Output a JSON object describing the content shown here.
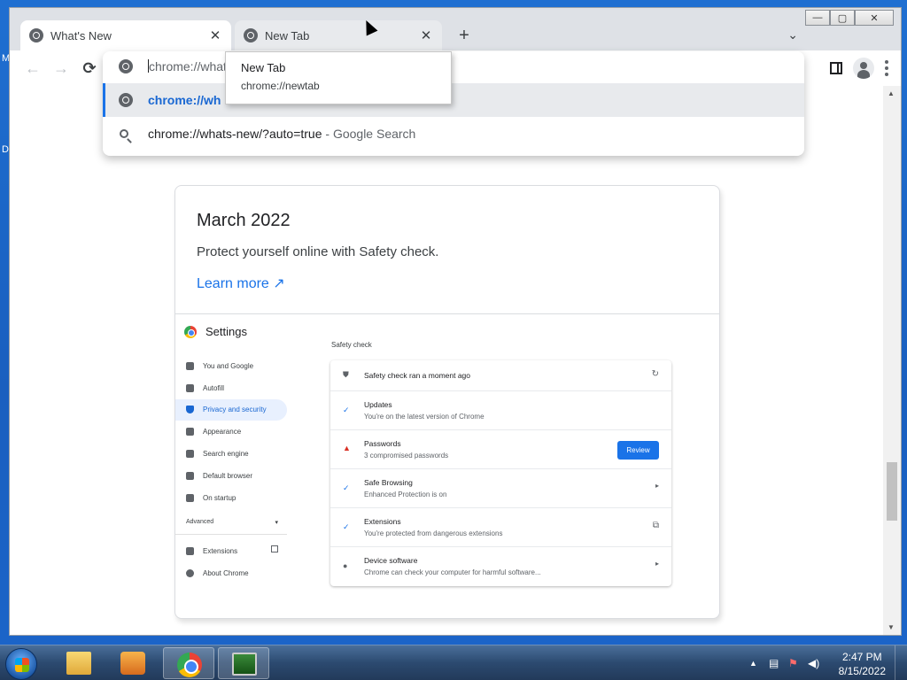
{
  "window": {
    "tabs": [
      {
        "label": "What's New",
        "active": true
      },
      {
        "label": "New Tab",
        "active": false
      }
    ],
    "new_tab_symbol": "+",
    "controls": {
      "minimize": "—",
      "maximize": "▢",
      "close": "✕"
    }
  },
  "toolbar": {
    "back": "←",
    "forward": "→",
    "reload": "⟳",
    "address_value": "chrome://what"
  },
  "omnibox": {
    "selected_suggestion": "chrome://wh",
    "search_suggestion_query": "chrome://whats-new/?auto=true",
    "search_suggestion_suffix": " - Google Search"
  },
  "tooltip": {
    "title": "New Tab",
    "url": "chrome://newtab"
  },
  "page": {
    "heading": "March 2022",
    "subtitle": "Protect yourself online with Safety check.",
    "learn_more": "Learn more ↗"
  },
  "settings_illustration": {
    "title": "Settings",
    "nav_items": [
      {
        "label": "You and Google",
        "active": false
      },
      {
        "label": "Autofill",
        "active": false
      },
      {
        "label": "Privacy and security",
        "active": true
      },
      {
        "label": "Appearance",
        "active": false
      },
      {
        "label": "Search engine",
        "active": false
      },
      {
        "label": "Default browser",
        "active": false
      },
      {
        "label": "On startup",
        "active": false
      }
    ],
    "advanced_label": "Advanced",
    "nav_items_2": [
      {
        "label": "Extensions"
      },
      {
        "label": "About Chrome"
      }
    ],
    "safety_check": {
      "heading": "Safety check",
      "status": "Safety check ran a moment ago",
      "rows": [
        {
          "title": "Updates",
          "detail": "You're on the latest version of Chrome"
        },
        {
          "title": "Passwords",
          "detail": "3 compromised passwords",
          "button": "Review"
        },
        {
          "title": "Safe Browsing",
          "detail": "Enhanced Protection is on"
        },
        {
          "title": "Extensions",
          "detail": "You're protected from dangerous extensions"
        },
        {
          "title": "Device software",
          "detail": "Chrome can check your computer for harmful software..."
        }
      ]
    }
  },
  "taskbar": {
    "time": "2:47 PM",
    "date": "8/15/2022"
  },
  "desktop": {
    "edge_letters": [
      "M",
      "D"
    ]
  },
  "colors": {
    "accent": "#1a73e8",
    "taskbar": "#2c4a70"
  }
}
